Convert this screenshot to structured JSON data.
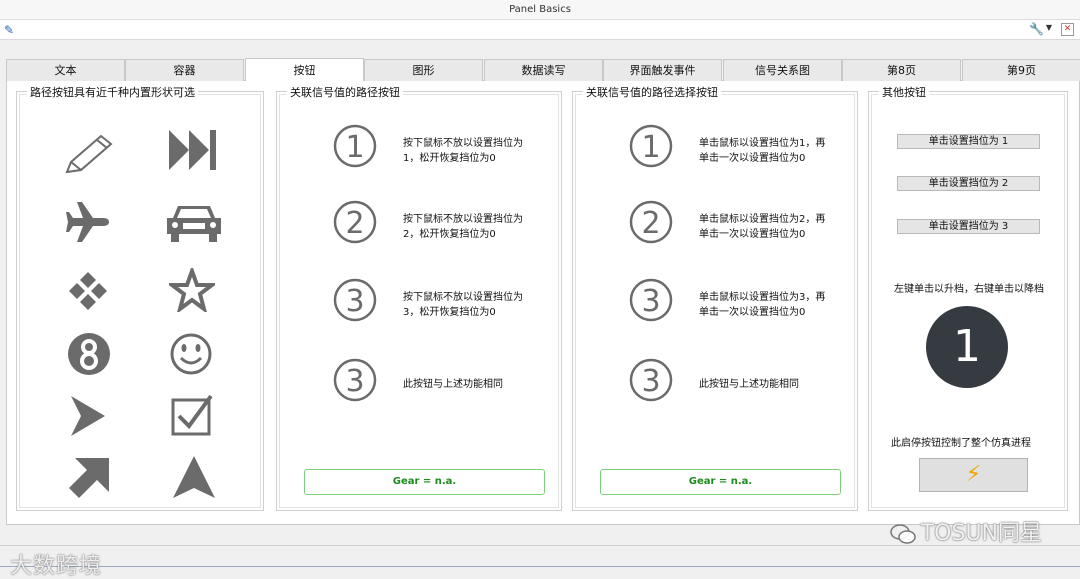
{
  "window": {
    "title": "Panel Basics"
  },
  "tabs": [
    {
      "label": "文本",
      "active": false
    },
    {
      "label": "容器",
      "active": false
    },
    {
      "label": "按钮",
      "active": true
    },
    {
      "label": "图形",
      "active": false
    },
    {
      "label": "数据读写",
      "active": false
    },
    {
      "label": "界面触发事件",
      "active": false
    },
    {
      "label": "信号关系图",
      "active": false
    },
    {
      "label": "第8页",
      "active": false
    },
    {
      "label": "第9页",
      "active": false
    }
  ],
  "panel_shapes": {
    "title": "路径按钮具有近千种内置形状可选",
    "icons": [
      "pencil-icon",
      "skip-forward-icon",
      "airplane-icon",
      "car-icon",
      "diamond-arrows-icon",
      "star-icon",
      "number-8-icon",
      "smiley-icon",
      "send-arrow-icon",
      "checkbox-icon",
      "up-right-arrow-icon",
      "navigation-arrow-icon"
    ]
  },
  "panel_path_buttons": {
    "title": "关联信号值的路径按钮",
    "rows": [
      {
        "symbol": "①",
        "text1": "按下鼠标不放以设置挡位为",
        "text2": "1，松开恢复挡位为0"
      },
      {
        "symbol": "②",
        "text1": "按下鼠标不放以设置挡位为",
        "text2": "2，松开恢复挡位为0"
      },
      {
        "symbol": "③",
        "text1": "按下鼠标不放以设置挡位为",
        "text2": "3，松开恢复挡位为0"
      },
      {
        "symbol": "③",
        "text1": "此按钮与上述功能相同",
        "text2": ""
      }
    ],
    "gear": "Gear = n.a."
  },
  "panel_select_buttons": {
    "title": "关联信号值的路径选择按钮",
    "rows": [
      {
        "symbol": "①",
        "text1": "单击鼠标以设置挡位为1，再",
        "text2": "单击一次以设置挡位为0"
      },
      {
        "symbol": "②",
        "text1": "单击鼠标以设置挡位为2，再",
        "text2": "单击一次以设置挡位为0"
      },
      {
        "symbol": "③",
        "text1": "单击鼠标以设置挡位为3，再",
        "text2": "单击一次以设置挡位为0"
      },
      {
        "symbol": "③",
        "text1": "此按钮与上述功能相同",
        "text2": ""
      }
    ],
    "gear": "Gear = n.a."
  },
  "panel_other": {
    "title": "其他按钮",
    "buttons": [
      "单击设置挡位为 1",
      "单击设置挡位为 2",
      "单击设置挡位为 3"
    ],
    "knob_hint": "左键单击以升档，右键单击以降档",
    "knob_value": "1",
    "sim_hint": "此启停按钮控制了整个仿真进程"
  },
  "watermarks": {
    "left": "大数跨境",
    "right": "TOSUN同星"
  },
  "colors": {
    "gear_text": "#1c8a1c",
    "gear_border": "#7fcf7f",
    "knob_bg": "#353b40",
    "bolt": "#f0a400",
    "icon_gray": "#6b6b6b"
  }
}
